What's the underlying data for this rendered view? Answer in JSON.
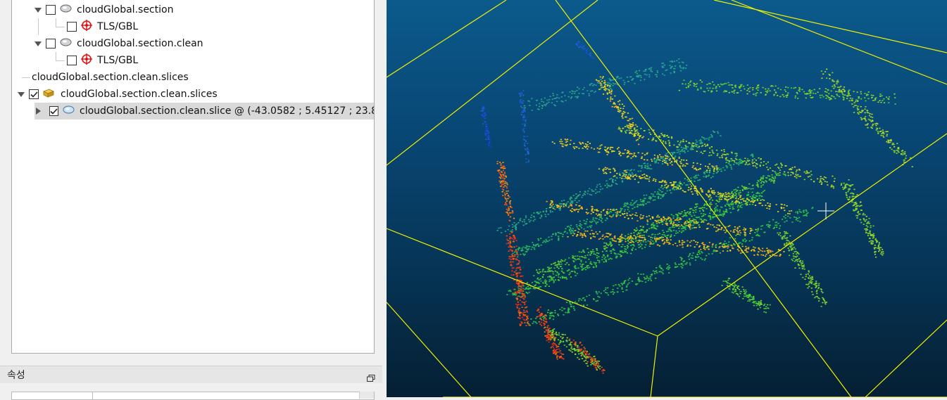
{
  "db_tree": {
    "items": [
      {
        "label": "cloudGlobal.section",
        "checked": false,
        "expanded": true,
        "icon": "point-cloud-icon"
      },
      {
        "label": "TLS/GBL",
        "checked": false,
        "icon": "sensor-icon"
      },
      {
        "label": "cloudGlobal.section.clean",
        "checked": false,
        "expanded": true,
        "icon": "point-cloud-icon"
      },
      {
        "label": "TLS/GBL",
        "checked": false,
        "icon": "sensor-icon"
      },
      {
        "label": "cloudGlobal.section.clean.slices"
      },
      {
        "label": "cloudGlobal.section.clean.slices",
        "checked": true,
        "expanded": true,
        "icon": "folder-group-icon"
      },
      {
        "label": "cloudGlobal.section.clean.slice  @  (-43.0582 ; 5.45127 ; 23.8...",
        "checked": true,
        "expanded": false,
        "selected": true,
        "icon": "point-cloud-icon"
      }
    ]
  },
  "properties": {
    "title": "속성"
  },
  "viewer": {
    "background_top": "#0b5a8c",
    "background_bottom": "#051f33",
    "bbox_color": "#f0f000",
    "cursor": "crosshair-icon"
  }
}
